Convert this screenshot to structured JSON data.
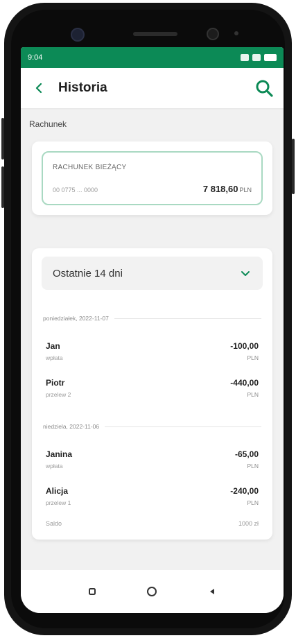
{
  "status": {
    "time": "9:04",
    "icons": "14 ⦿ ▮"
  },
  "appbar": {
    "title": "Historia",
    "back_icon": "back-chevron-icon",
    "search_icon": "search-icon"
  },
  "section_label": "Rachunek",
  "account": {
    "name": "RACHUNEK BIEŻĄCY",
    "number": "00 0775 ... 0000",
    "balance": "7 818,60",
    "currency": "PLN"
  },
  "history": {
    "period_label": "Ostatnie 14 dni",
    "groups": [
      {
        "date": "poniedziałek, 2022-11-07",
        "transactions": [
          {
            "title": "Jan",
            "subtitle": "wpłata",
            "amount": "-100,00",
            "currency": "PLN"
          },
          {
            "title": "Piotr",
            "subtitle": "przelew 2",
            "amount": "-440,00",
            "currency": "PLN"
          }
        ]
      },
      {
        "date": "niedziela, 2022-11-06",
        "transactions": [
          {
            "title": "Janina",
            "subtitle": "wpłata",
            "amount": "-65,00",
            "currency": "PLN"
          },
          {
            "title": "Alicja",
            "subtitle": "przelew 1",
            "amount": "-240,00",
            "currency": "PLN"
          }
        ]
      }
    ],
    "more_left": "Saldo",
    "more_right": "1000 zł"
  },
  "colors": {
    "brand": "#0c8a56",
    "card_border": "#a9d9c2"
  }
}
